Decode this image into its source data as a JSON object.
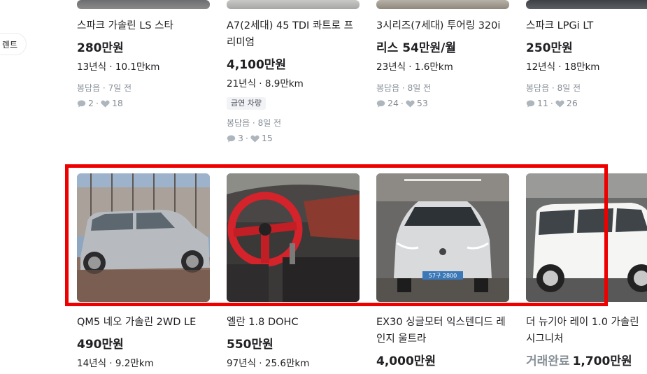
{
  "side_chip": {
    "label": "렌트"
  },
  "row1": [
    {
      "title": "스파크 가솔린 LS 스타",
      "price": "280만원",
      "meta": "13년식 · 10.1만km",
      "location": "봉담읍 · 7일 전",
      "chats": "2",
      "likes": "18"
    },
    {
      "title": "A7(2세대) 45 TDI 콰트로 프리미엄",
      "price": "4,100만원",
      "meta": "21년식 · 8.9만km",
      "badge": "금연 차량",
      "location": "봉담읍 · 8일 전",
      "chats": "3",
      "likes": "15"
    },
    {
      "title": "3시리즈(7세대) 투어링 320i",
      "price": "리스 54만원/월",
      "meta": "23년식 · 1.6만km",
      "location": "봉담읍 · 8일 전",
      "chats": "24",
      "likes": "53"
    },
    {
      "title": "스파크 LPGi LT",
      "price": "250만원",
      "meta": "12년식 · 18만km",
      "location": "봉담읍 · 8일 전",
      "chats": "11",
      "likes": "26"
    }
  ],
  "row2": [
    {
      "title": "QM5 네오 가솔린 2WD LE",
      "price": "490만원",
      "meta": "14년식 · 9.2만km"
    },
    {
      "title": "엘란 1.8 DOHC",
      "price": "550만원",
      "meta": "97년식 · 25.6만km"
    },
    {
      "title": "EX30 싱글모터 익스텐디드 레인지 울트라",
      "price": "4,000만원"
    },
    {
      "title": "더 뉴기아 레이 1.0 가솔린 시그니처",
      "status": "거래완료",
      "price": "1,700만원"
    }
  ],
  "plate_text": "57구 2800",
  "colors": {
    "highlight": "#ee0000",
    "muted": "#868e96",
    "text": "#212124"
  }
}
